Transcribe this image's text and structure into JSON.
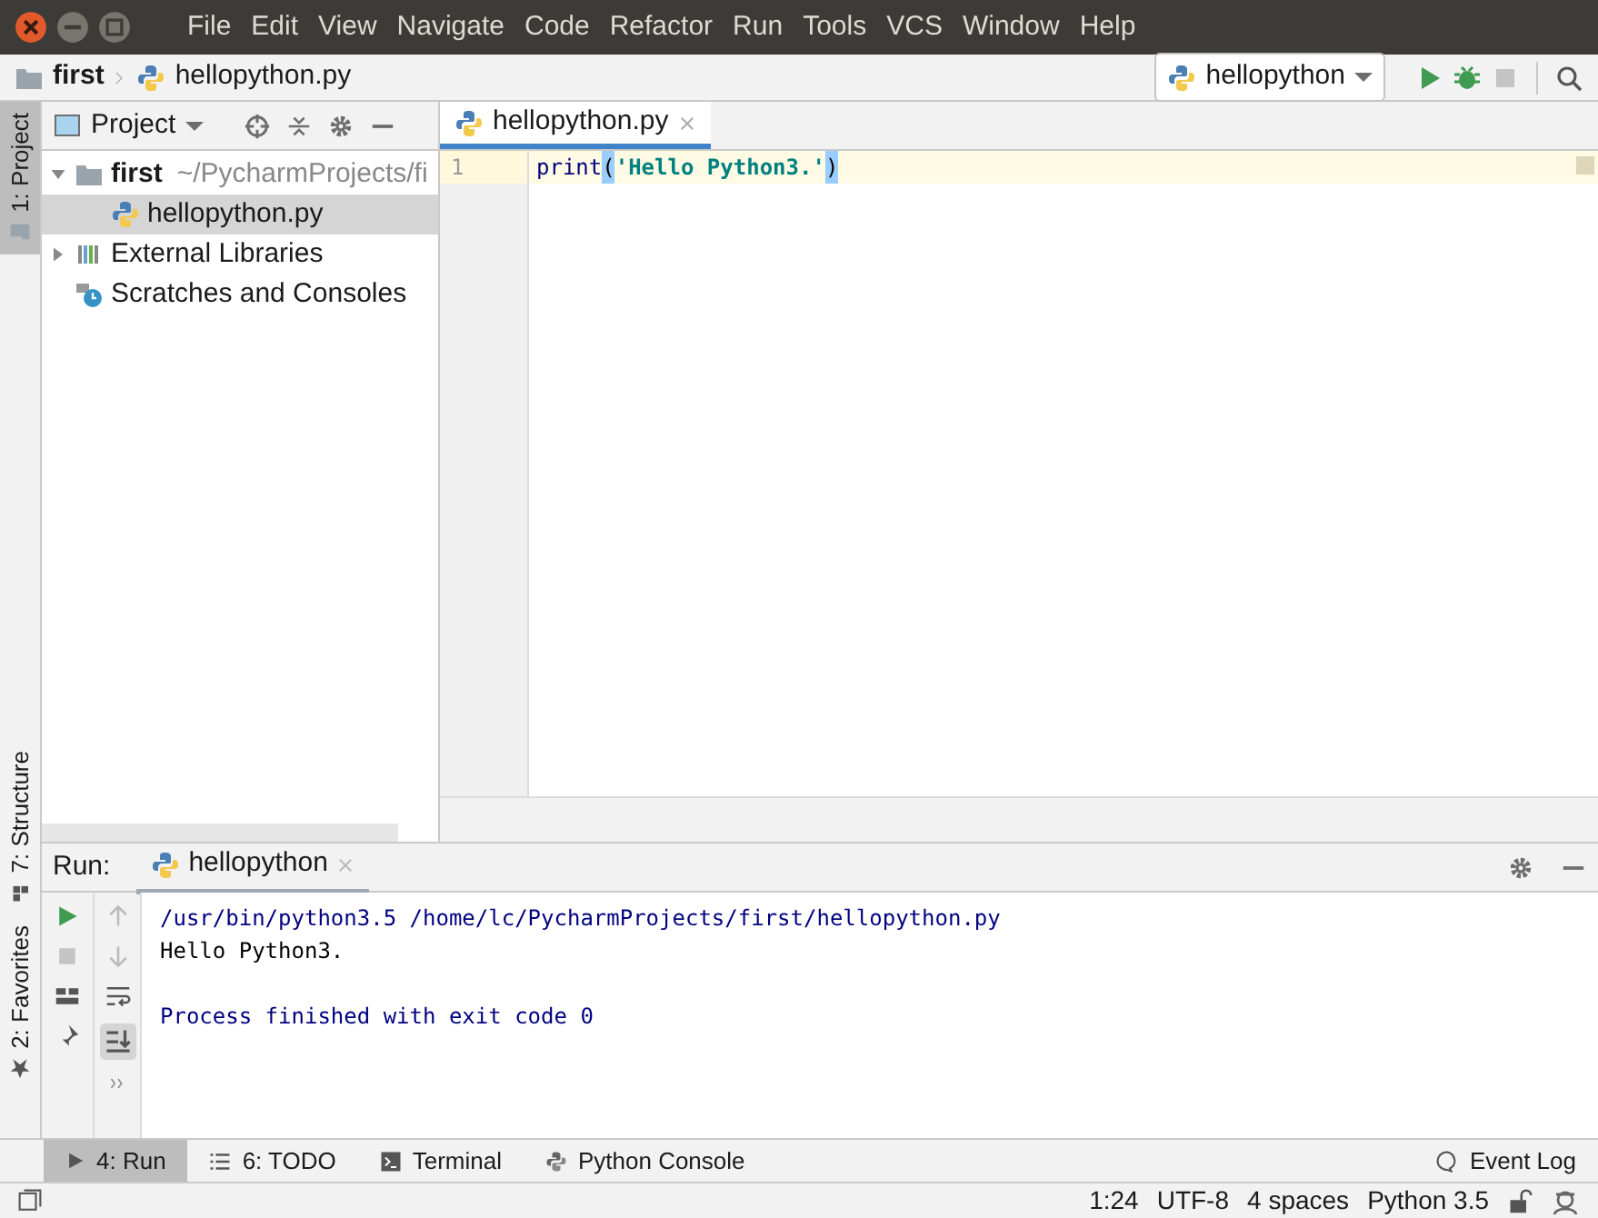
{
  "window": {
    "menu": [
      "File",
      "Edit",
      "View",
      "Navigate",
      "Code",
      "Refactor",
      "Run",
      "Tools",
      "VCS",
      "Window",
      "Help"
    ]
  },
  "navbar": {
    "breadcrumbs": [
      "first",
      "hellopython.py"
    ],
    "run_config": "hellopython"
  },
  "left_stripe": [
    {
      "label": "1: Project",
      "selected": true,
      "kind": "top"
    },
    {
      "label": "7: Structure",
      "selected": false,
      "kind": "bottom"
    },
    {
      "label": "2: Favorites",
      "selected": false,
      "kind": "bottom"
    }
  ],
  "project_panel": {
    "title": "Project",
    "tree": [
      {
        "label": "first",
        "path": "~/PycharmProjects/fi",
        "kind": "folder",
        "expanded": true,
        "selected": false,
        "children": [
          {
            "label": "hellopython.py",
            "kind": "python",
            "selected": true
          }
        ]
      },
      {
        "label": "External Libraries",
        "kind": "libraries",
        "expanded": false,
        "selected": false
      },
      {
        "label": "Scratches and Consoles",
        "kind": "scratches",
        "selected": false
      }
    ]
  },
  "editor": {
    "tabs": [
      {
        "label": "hellopython.py",
        "selected": true
      }
    ],
    "lines": [
      {
        "number": "1",
        "tokens": [
          {
            "kind": "builtin",
            "text": "print"
          },
          {
            "kind": "brace",
            "text": "("
          },
          {
            "kind": "string",
            "text": "'Hello Python3.'"
          },
          {
            "kind": "brace",
            "text": ")"
          }
        ]
      }
    ]
  },
  "run_panel": {
    "title": "Run:",
    "tabs": [
      {
        "label": "hellopython",
        "selected": true
      }
    ],
    "output": [
      {
        "kind": "system",
        "text": "/usr/bin/python3.5 /home/lc/PycharmProjects/first/hellopython.py"
      },
      {
        "kind": "stdout",
        "text": "Hello Python3."
      },
      {
        "kind": "system_gap",
        "text": "Process finished with exit code 0"
      }
    ]
  },
  "bottom_tools": [
    {
      "label": "4: Run",
      "kind": "run",
      "selected": true
    },
    {
      "label": "6: TODO",
      "kind": "todo",
      "selected": false
    },
    {
      "label": "Terminal",
      "kind": "terminal",
      "selected": false
    },
    {
      "label": "Python Console",
      "kind": "console",
      "selected": false
    }
  ],
  "event_log": "Event Log",
  "status_bar": [
    "1:24",
    "UTF-8",
    "4 spaces",
    "Python 3.5"
  ]
}
